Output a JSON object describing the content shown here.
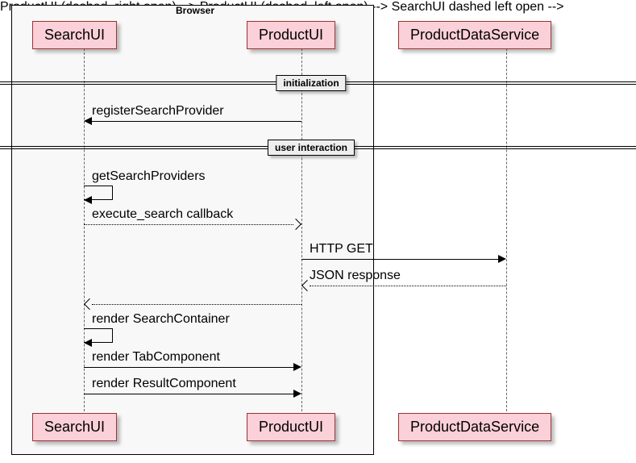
{
  "group": {
    "label": "Browser"
  },
  "participants": {
    "searchUI": "SearchUI",
    "productUI": "ProductUI",
    "productDataService": "ProductDataService"
  },
  "dividers": {
    "init": "initialization",
    "userInteraction": "user interaction"
  },
  "messages": {
    "registerSearchProvider": "registerSearchProvider",
    "getSearchProviders": "getSearchProviders",
    "executeSearchCallback": "execute_search callback",
    "httpGet": "HTTP GET",
    "jsonResponse": "JSON response",
    "renderSearchContainer": "render SearchContainer",
    "renderTabComponent": "render TabComponent",
    "renderResultComponent": "render ResultComponent"
  }
}
